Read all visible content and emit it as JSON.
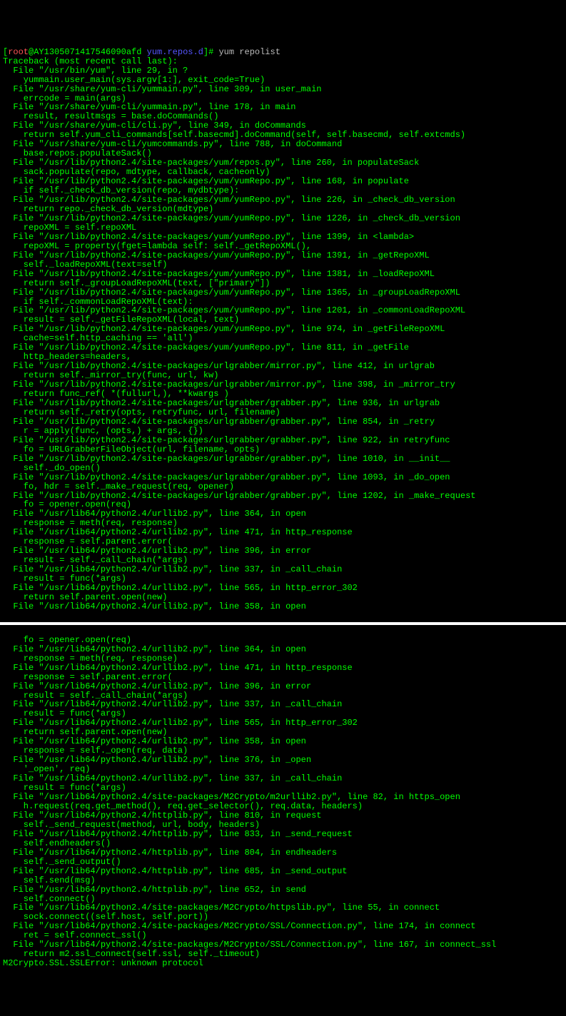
{
  "prompt": {
    "open": "[",
    "user": "root",
    "at": "@",
    "host": "AY1305071417546090afd",
    "space": " ",
    "dir": "yum.repos.d",
    "close": "]# ",
    "command": "yum repolist"
  },
  "block1": [
    "Traceback (most recent call last):",
    "  File \"/usr/bin/yum\", line 29, in ?",
    "    yummain.user_main(sys.argv[1:], exit_code=True)",
    "  File \"/usr/share/yum-cli/yummain.py\", line 309, in user_main",
    "    errcode = main(args)",
    "  File \"/usr/share/yum-cli/yummain.py\", line 178, in main",
    "    result, resultmsgs = base.doCommands()",
    "  File \"/usr/share/yum-cli/cli.py\", line 349, in doCommands",
    "    return self.yum_cli_commands[self.basecmd].doCommand(self, self.basecmd, self.extcmds)",
    "  File \"/usr/share/yum-cli/yumcommands.py\", line 788, in doCommand",
    "    base.repos.populateSack()",
    "  File \"/usr/lib/python2.4/site-packages/yum/repos.py\", line 260, in populateSack",
    "    sack.populate(repo, mdtype, callback, cacheonly)",
    "  File \"/usr/lib/python2.4/site-packages/yum/yumRepo.py\", line 168, in populate",
    "    if self._check_db_version(repo, mydbtype):",
    "  File \"/usr/lib/python2.4/site-packages/yum/yumRepo.py\", line 226, in _check_db_version",
    "    return repo._check_db_version(mdtype)",
    "  File \"/usr/lib/python2.4/site-packages/yum/yumRepo.py\", line 1226, in _check_db_version",
    "    repoXML = self.repoXML",
    "  File \"/usr/lib/python2.4/site-packages/yum/yumRepo.py\", line 1399, in <lambda>",
    "    repoXML = property(fget=lambda self: self._getRepoXML(),",
    "  File \"/usr/lib/python2.4/site-packages/yum/yumRepo.py\", line 1391, in _getRepoXML",
    "    self._loadRepoXML(text=self)",
    "  File \"/usr/lib/python2.4/site-packages/yum/yumRepo.py\", line 1381, in _loadRepoXML",
    "    return self._groupLoadRepoXML(text, [\"primary\"])",
    "  File \"/usr/lib/python2.4/site-packages/yum/yumRepo.py\", line 1365, in _groupLoadRepoXML",
    "    if self._commonLoadRepoXML(text):",
    "  File \"/usr/lib/python2.4/site-packages/yum/yumRepo.py\", line 1201, in _commonLoadRepoXML",
    "    result = self._getFileRepoXML(local, text)",
    "  File \"/usr/lib/python2.4/site-packages/yum/yumRepo.py\", line 974, in _getFileRepoXML",
    "    cache=self.http_caching == 'all')",
    "  File \"/usr/lib/python2.4/site-packages/yum/yumRepo.py\", line 811, in _getFile",
    "    http_headers=headers,",
    "  File \"/usr/lib/python2.4/site-packages/urlgrabber/mirror.py\", line 412, in urlgrab",
    "    return self._mirror_try(func, url, kw)",
    "  File \"/usr/lib/python2.4/site-packages/urlgrabber/mirror.py\", line 398, in _mirror_try",
    "    return func_ref( *(fullurl,), **kwargs )",
    "  File \"/usr/lib/python2.4/site-packages/urlgrabber/grabber.py\", line 936, in urlgrab",
    "    return self._retry(opts, retryfunc, url, filename)",
    "  File \"/usr/lib/python2.4/site-packages/urlgrabber/grabber.py\", line 854, in _retry",
    "    r = apply(func, (opts,) + args, {})",
    "  File \"/usr/lib/python2.4/site-packages/urlgrabber/grabber.py\", line 922, in retryfunc",
    "    fo = URLGrabberFileObject(url, filename, opts)",
    "  File \"/usr/lib/python2.4/site-packages/urlgrabber/grabber.py\", line 1010, in __init__",
    "    self._do_open()",
    "  File \"/usr/lib/python2.4/site-packages/urlgrabber/grabber.py\", line 1093, in _do_open",
    "    fo, hdr = self._make_request(req, opener)",
    "  File \"/usr/lib/python2.4/site-packages/urlgrabber/grabber.py\", line 1202, in _make_request",
    "    fo = opener.open(req)",
    "  File \"/usr/lib64/python2.4/urllib2.py\", line 364, in open",
    "    response = meth(req, response)",
    "  File \"/usr/lib64/python2.4/urllib2.py\", line 471, in http_response",
    "    response = self.parent.error(",
    "  File \"/usr/lib64/python2.4/urllib2.py\", line 396, in error",
    "    result = self._call_chain(*args)",
    "  File \"/usr/lib64/python2.4/urllib2.py\", line 337, in _call_chain",
    "    result = func(*args)",
    "  File \"/usr/lib64/python2.4/urllib2.py\", line 565, in http_error_302",
    "    return self.parent.open(new)",
    "  File \"/usr/lib64/python2.4/urllib2.py\", line 358, in open"
  ],
  "block2": [
    "    fo = opener.open(req)",
    "  File \"/usr/lib64/python2.4/urllib2.py\", line 364, in open",
    "    response = meth(req, response)",
    "  File \"/usr/lib64/python2.4/urllib2.py\", line 471, in http_response",
    "    response = self.parent.error(",
    "  File \"/usr/lib64/python2.4/urllib2.py\", line 396, in error",
    "    result = self._call_chain(*args)",
    "  File \"/usr/lib64/python2.4/urllib2.py\", line 337, in _call_chain",
    "    result = func(*args)",
    "  File \"/usr/lib64/python2.4/urllib2.py\", line 565, in http_error_302",
    "    return self.parent.open(new)",
    "  File \"/usr/lib64/python2.4/urllib2.py\", line 358, in open",
    "    response = self._open(req, data)",
    "  File \"/usr/lib64/python2.4/urllib2.py\", line 376, in _open",
    "    '_open', req)",
    "  File \"/usr/lib64/python2.4/urllib2.py\", line 337, in _call_chain",
    "    result = func(*args)",
    "  File \"/usr/lib64/python2.4/site-packages/M2Crypto/m2urllib2.py\", line 82, in https_open",
    "    h.request(req.get_method(), req.get_selector(), req.data, headers)",
    "  File \"/usr/lib64/python2.4/httplib.py\", line 810, in request",
    "    self._send_request(method, url, body, headers)",
    "  File \"/usr/lib64/python2.4/httplib.py\", line 833, in _send_request",
    "    self.endheaders()",
    "  File \"/usr/lib64/python2.4/httplib.py\", line 804, in endheaders",
    "    self._send_output()",
    "  File \"/usr/lib64/python2.4/httplib.py\", line 685, in _send_output",
    "    self.send(msg)",
    "  File \"/usr/lib64/python2.4/httplib.py\", line 652, in send",
    "    self.connect()",
    "  File \"/usr/lib64/python2.4/site-packages/M2Crypto/httpslib.py\", line 55, in connect",
    "    sock.connect((self.host, self.port))",
    "  File \"/usr/lib64/python2.4/site-packages/M2Crypto/SSL/Connection.py\", line 174, in connect",
    "    ret = self.connect_ssl()",
    "  File \"/usr/lib64/python2.4/site-packages/M2Crypto/SSL/Connection.py\", line 167, in connect_ssl",
    "    return m2.ssl_connect(self.ssl, self._timeout)",
    "M2Crypto.SSL.SSLError: unknown protocol"
  ]
}
